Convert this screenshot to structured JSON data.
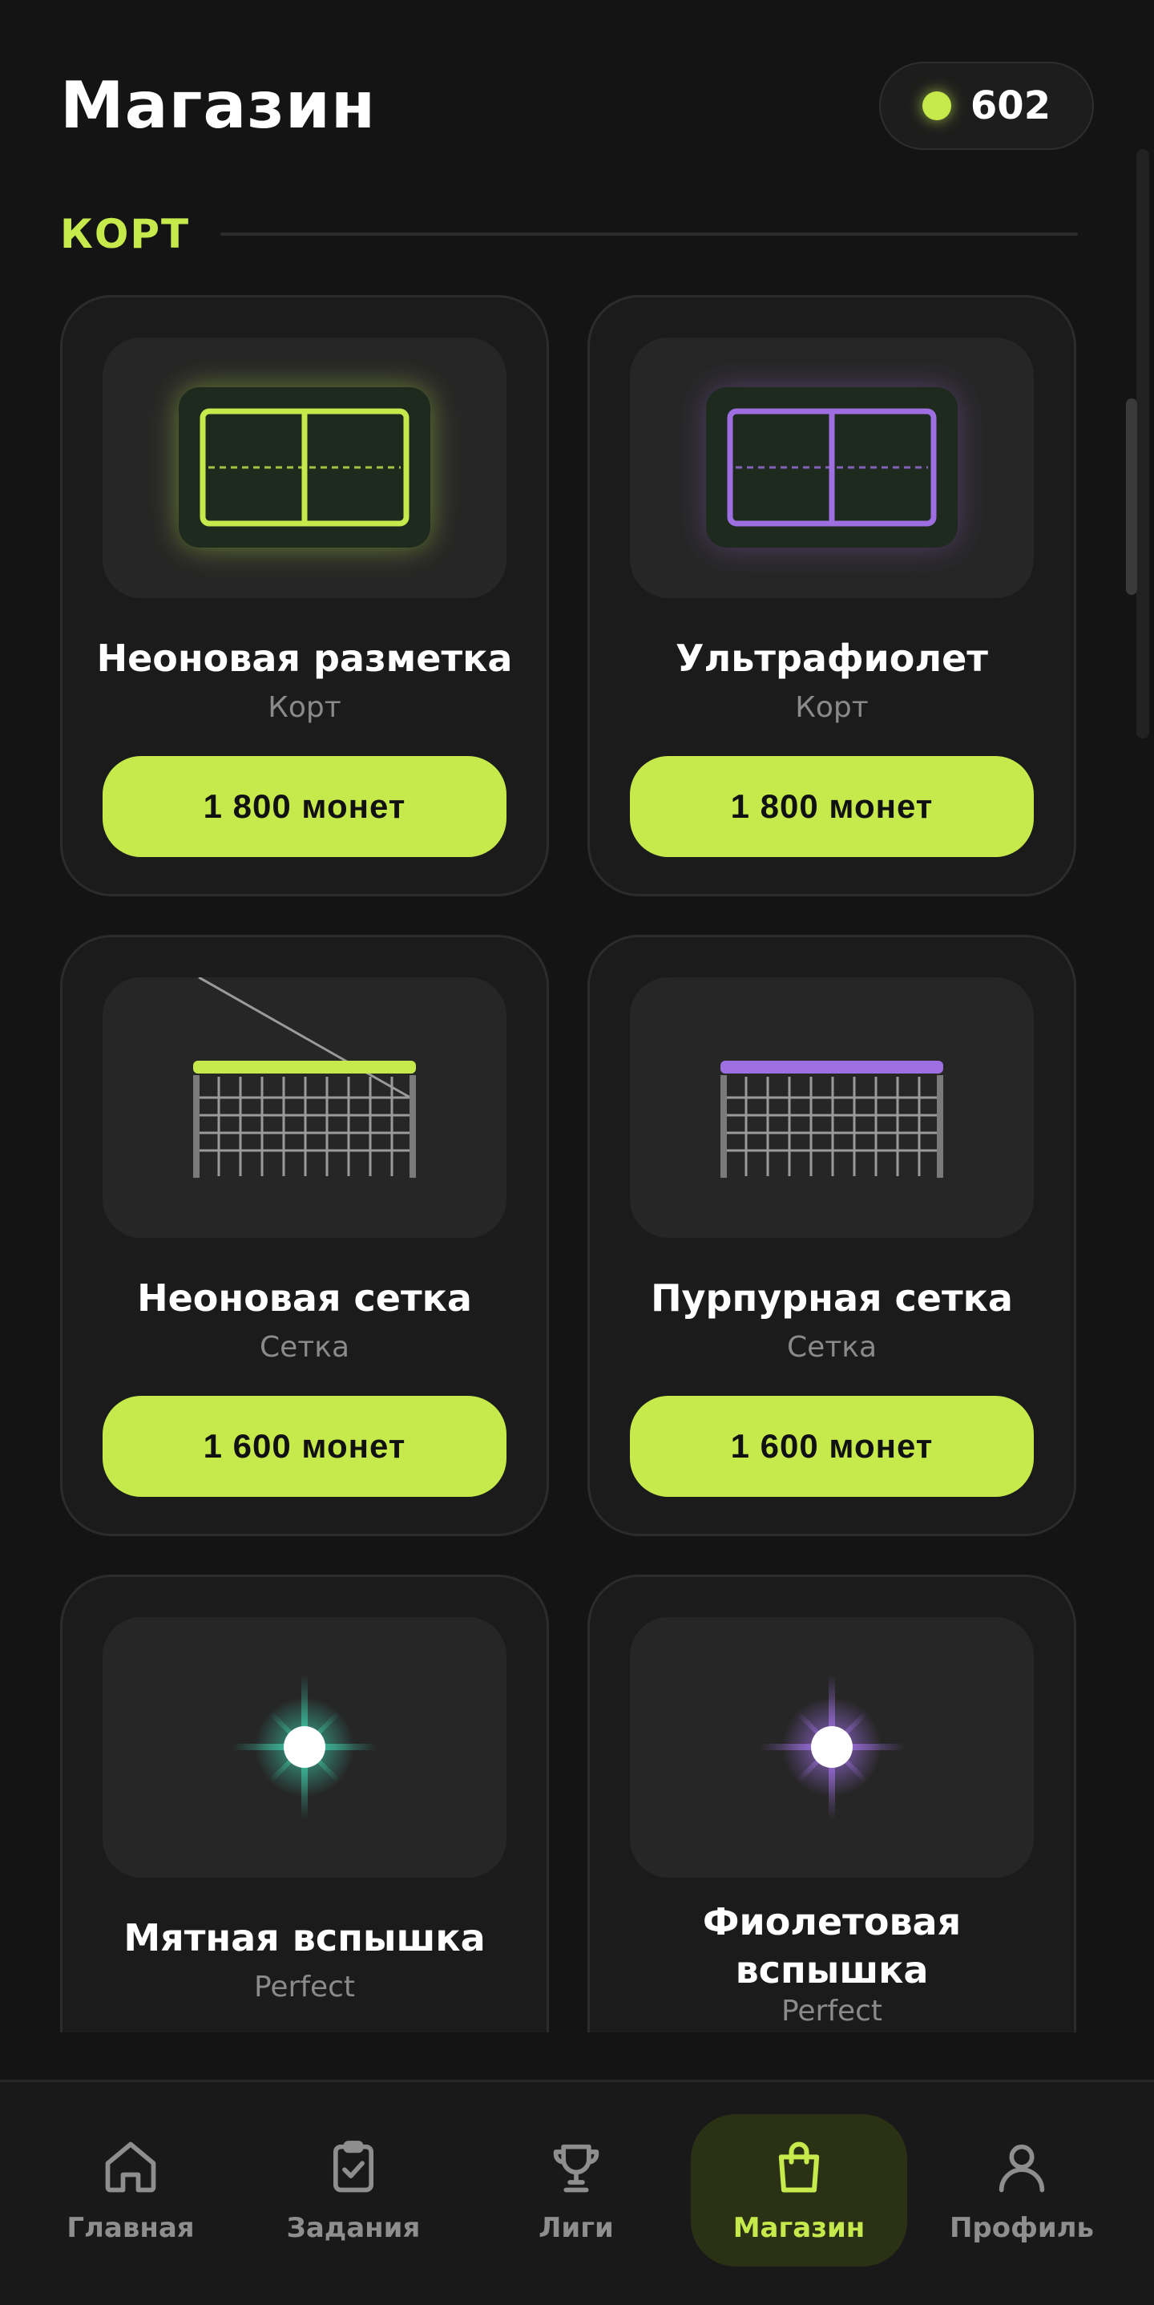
{
  "header": {
    "title": "Магазин",
    "coins": "602"
  },
  "section": {
    "title": "КОРТ"
  },
  "items": [
    {
      "name": "Неоновая разметка",
      "category": "Корт",
      "price": "1 800 монет",
      "icon": "court-icon",
      "color": "#c6ea4c"
    },
    {
      "name": "Ультрафиолет",
      "category": "Корт",
      "price": "1 800 монет",
      "icon": "court-icon",
      "color": "#9d6fe0"
    },
    {
      "name": "Неоновая сетка",
      "category": "Сетка",
      "price": "1 600 монет",
      "icon": "net-icon",
      "color": "#c6ea4c"
    },
    {
      "name": "Пурпурная сетка",
      "category": "Сетка",
      "price": "1 600 монет",
      "icon": "net-icon",
      "color": "#9d6fe0"
    },
    {
      "name": "Мятная вспышка",
      "category": "Perfect",
      "price": "",
      "icon": "sparkle-icon",
      "color": "#3ec4a4"
    },
    {
      "name": "Фиолетовая вспышка",
      "category": "Perfect",
      "price": "",
      "icon": "sparkle-icon",
      "color": "#9d6fe0"
    }
  ],
  "nav": {
    "items": [
      {
        "label": "Главная",
        "icon": "home-icon"
      },
      {
        "label": "Задания",
        "icon": "clipboard-check-icon"
      },
      {
        "label": "Лиги",
        "icon": "trophy-icon"
      },
      {
        "label": "Магазин",
        "icon": "shopping-bag-icon"
      },
      {
        "label": "Профиль",
        "icon": "user-icon"
      }
    ],
    "active": "Магазин"
  },
  "colors": {
    "accent": "#c6ea4c",
    "purple": "#9d6fe0",
    "mint": "#3ec4a4",
    "background": "#141414"
  }
}
